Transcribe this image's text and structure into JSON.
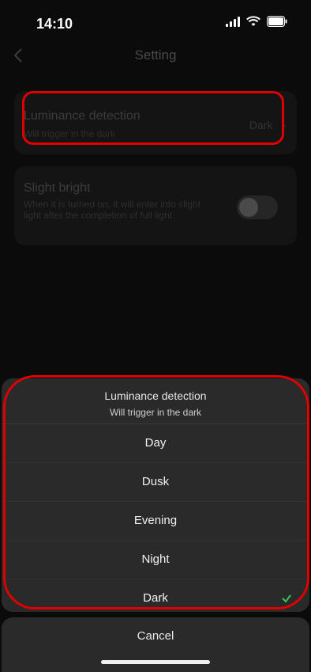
{
  "status_bar": {
    "time": "14:10"
  },
  "nav": {
    "title": "Setting"
  },
  "luminance_card": {
    "title": "Luminance detection",
    "subtitle": "Will trigger in the dark",
    "value": "Dark"
  },
  "slight_card": {
    "title": "Slight bright",
    "description": "When it is turned on, it will enter into slight light after the completion of full light",
    "toggle_on": false
  },
  "sheet": {
    "title": "Luminance detection",
    "subtitle": "Will trigger in the dark",
    "options": [
      "Day",
      "Dusk",
      "Evening",
      "Night",
      "Dark"
    ],
    "selected": "Dark",
    "check_color": "#34c759"
  },
  "cancel_label": "Cancel",
  "highlight_color": "#e00000"
}
